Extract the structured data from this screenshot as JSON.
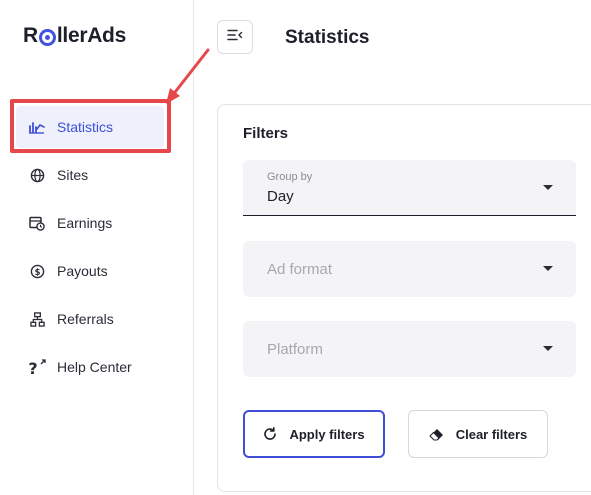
{
  "brand": {
    "logo_text_before": "R",
    "logo_text_after": "llerAds",
    "accent": "#4153e0"
  },
  "sidebar": {
    "items": [
      {
        "label": "Statistics",
        "icon": "chart-icon",
        "active": true
      },
      {
        "label": "Sites",
        "icon": "globe-icon",
        "active": false
      },
      {
        "label": "Earnings",
        "icon": "wallet-clock-icon",
        "active": false
      },
      {
        "label": "Payouts",
        "icon": "coin-icon",
        "active": false
      },
      {
        "label": "Referrals",
        "icon": "network-icon",
        "active": false
      },
      {
        "label": "Help Center",
        "icon": "question-external-icon",
        "active": false
      }
    ]
  },
  "header": {
    "title": "Statistics",
    "toggle_icon": "collapse-menu-icon"
  },
  "filters": {
    "title": "Filters",
    "group_by": {
      "label": "Group by",
      "value": "Day"
    },
    "ad_format": {
      "placeholder": "Ad format"
    },
    "platform": {
      "placeholder": "Platform"
    },
    "apply_label": "Apply filters",
    "clear_label": "Clear filters"
  },
  "annotation": {
    "color": "#e5474b"
  }
}
